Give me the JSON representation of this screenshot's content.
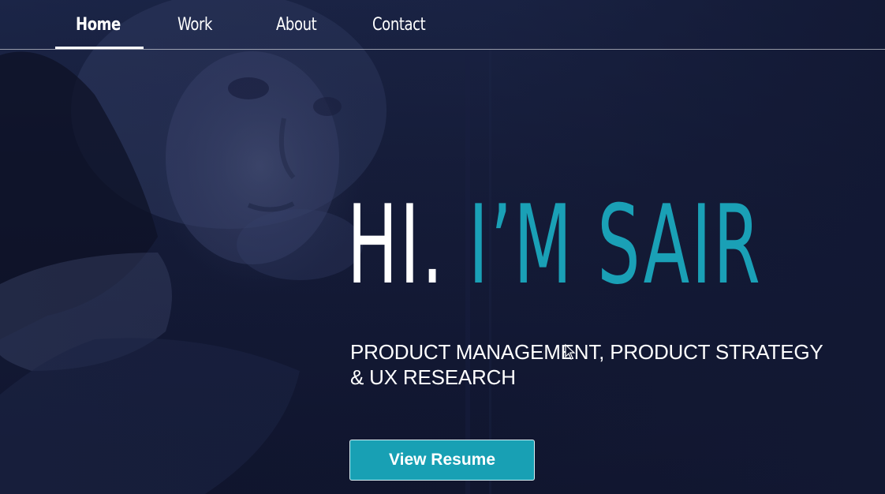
{
  "nav": {
    "items": [
      {
        "label": "Home",
        "active": true
      },
      {
        "label": "Work",
        "active": false
      },
      {
        "label": "About",
        "active": false
      },
      {
        "label": "Contact",
        "active": false
      }
    ]
  },
  "hero": {
    "greeting": "HI.",
    "name": "I’M SAIR",
    "tagline_line1": "PRODUCT MANAGEMENT, PRODUCT STRATEGY",
    "tagline_line2": "& UX RESEARCH",
    "cta_label": "View Resume",
    "background_image": "portrait-with-cat"
  },
  "colors": {
    "accent": "#1aa0b6",
    "background": "#141a33",
    "text": "#ffffff"
  },
  "icons": {
    "cursor": "text-cursor-icon"
  }
}
